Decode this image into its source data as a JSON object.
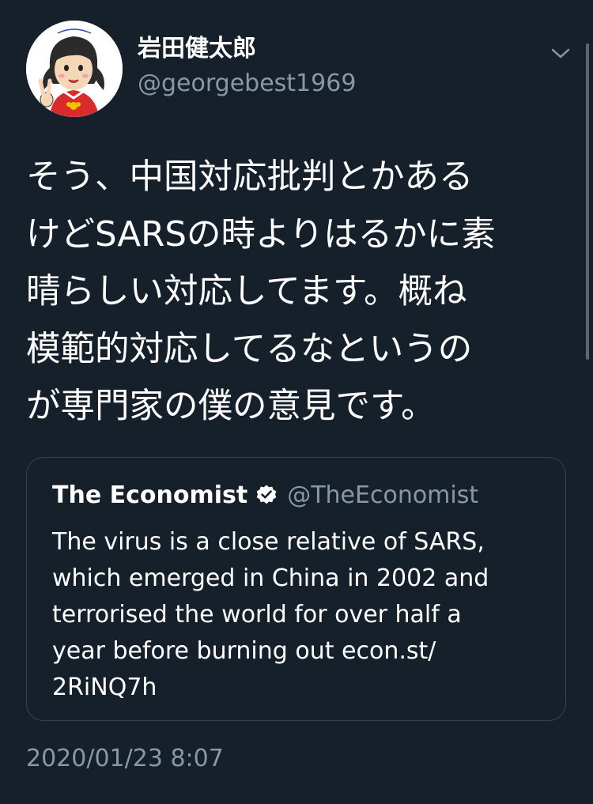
{
  "author": {
    "name": "岩田健太郎",
    "handle": "@georgebest1969"
  },
  "tweet": {
    "lines": [
      "そう、中国対応批判とかある",
      "けどSARSの時よりはるかに素",
      "晴らしい対応してます。概ね",
      "模範的対応してるなというの",
      "が専門家の僕の意見です。"
    ]
  },
  "quote": {
    "name": "The Economist",
    "handle": "@TheEconomist",
    "lines": [
      "The virus is a close relative of SARS,",
      "which emerged in China in 2002 and",
      "terrorised the world for over half a",
      "year before burning out econ.st/",
      "2RiNQ7h"
    ]
  },
  "timestamp": "2020/01/23 8:07",
  "icons": {
    "menu": "chevron-down-icon",
    "verified": "verified-badge-icon"
  },
  "colors": {
    "background": "#15202b",
    "secondary_text": "#8899a6",
    "border": "#38444d"
  }
}
